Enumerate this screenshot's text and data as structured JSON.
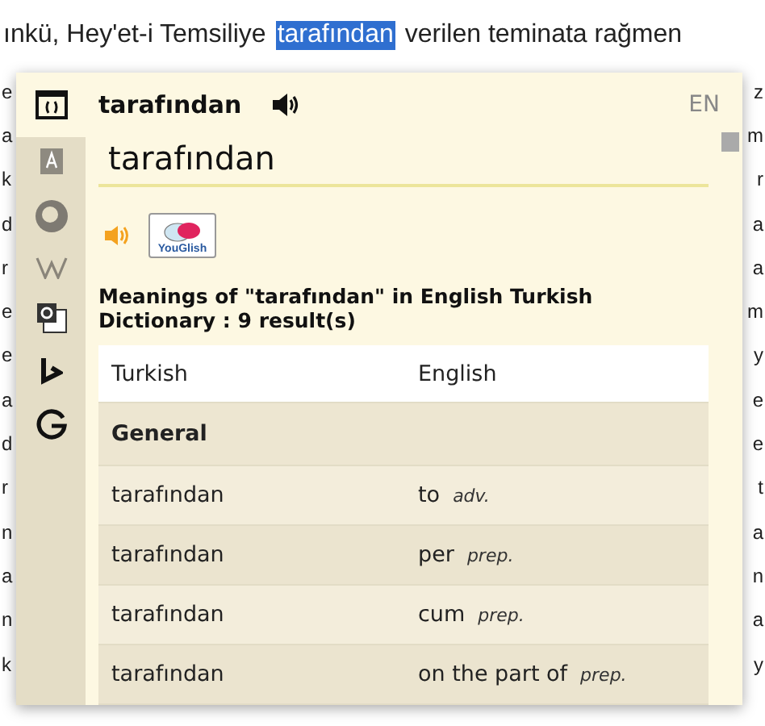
{
  "document": {
    "line": {
      "before": "ınkü, Hey'et-i Temsiliye",
      "selection": "tarafından",
      "after": "verilen teminata rağmen"
    },
    "left_fragments": [
      "e",
      "a",
      "k",
      "d",
      "r",
      "e",
      "e",
      "a",
      "d",
      "r",
      "n",
      "a",
      "n",
      "k"
    ],
    "right_fragments": [
      "z",
      "m",
      "r",
      "a",
      "a",
      "m",
      "y",
      "e",
      "e",
      "t",
      "a",
      "n",
      "a",
      "y"
    ]
  },
  "popup": {
    "header": {
      "word": "tarafından",
      "language": "EN"
    },
    "search": {
      "value": "tarafından"
    },
    "youglish": {
      "label": "YouGlish"
    },
    "result_summary": "Meanings of \"tarafından\" in English Turkish Dictionary : 9 result(s)",
    "table": {
      "columns": [
        "Turkish",
        "English"
      ],
      "sections": [
        {
          "title": "General",
          "rows": [
            {
              "turkish": "tarafından",
              "english": "to",
              "pos": "adv."
            },
            {
              "turkish": "tarafından",
              "english": "per",
              "pos": "prep."
            },
            {
              "turkish": "tarafından",
              "english": "cum",
              "pos": "prep."
            },
            {
              "turkish": "tarafından",
              "english": "on the part of",
              "pos": "prep."
            }
          ]
        }
      ]
    }
  }
}
